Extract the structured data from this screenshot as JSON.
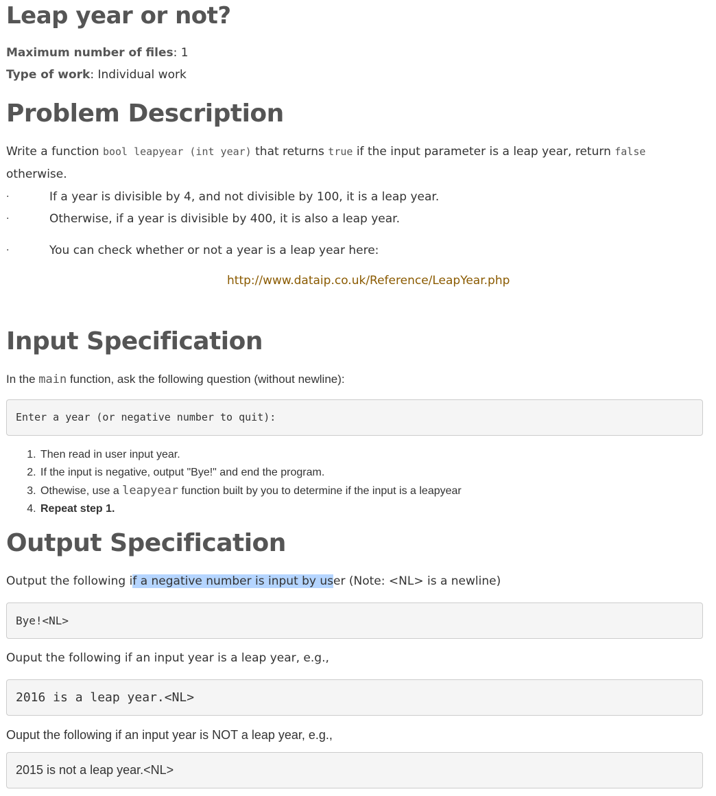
{
  "title": "Leap year or not?",
  "meta": {
    "max_files_label": "Maximum number of files",
    "max_files_value": ": 1",
    "work_type_label": "Type of work",
    "work_type_value": ": Individual work"
  },
  "problem": {
    "heading": "Problem Description",
    "intro_1": "Write a function ",
    "signature": "bool leapyear (int year)",
    "intro_2": " that returns ",
    "true_kw": "true",
    "intro_3": " if the input parameter is a leap year, return ",
    "false_kw": "false",
    "intro_4": "otherwise.",
    "bullets": [
      "If a year is divisible by 4, and not divisible by 100, it is a leap year.",
      "Otherwise, if a year is divisible by 400, it is also a leap year.",
      "You can check whether or not a year is a leap year here:"
    ],
    "bullet_dot": "·",
    "link": "http://www.dataip.co.uk/Reference/LeapYear.php"
  },
  "input": {
    "heading": "Input Specification",
    "intro_1": "In the ",
    "main_kw": "main",
    "intro_2": " function, ask the following question (without newline):",
    "prompt_code": "Enter a year (or negative number to quit):",
    "steps": [
      {
        "text_before": "Then read in user input year.",
        "code": "",
        "text_after": ""
      },
      {
        "text_before": "If the input is negative, output \"Bye!\" and end the program.",
        "code": "",
        "text_after": ""
      },
      {
        "text_before": "Othewise, use a ",
        "code": "leapyear",
        "text_after": " function built by you to determine if the input is a leapyear"
      },
      {
        "text_before": "",
        "code": "",
        "text_after": "",
        "bold": "Repeat step 1."
      }
    ]
  },
  "output": {
    "heading": "Output Specification",
    "line1_before": "Output the following i",
    "line1_highlight": "f a negative number is input by us",
    "line1_after": "er (Note: <NL> is a newline)",
    "code1": "Bye!<NL>",
    "line2": "Ouput the following if an input year is a leap year, e.g.,",
    "code2": "2016 is a leap year.<NL>",
    "line3": "Ouput the following if an input year is NOT a leap year, e.g.,",
    "code3": "2015 is not a leap year.<NL>"
  }
}
